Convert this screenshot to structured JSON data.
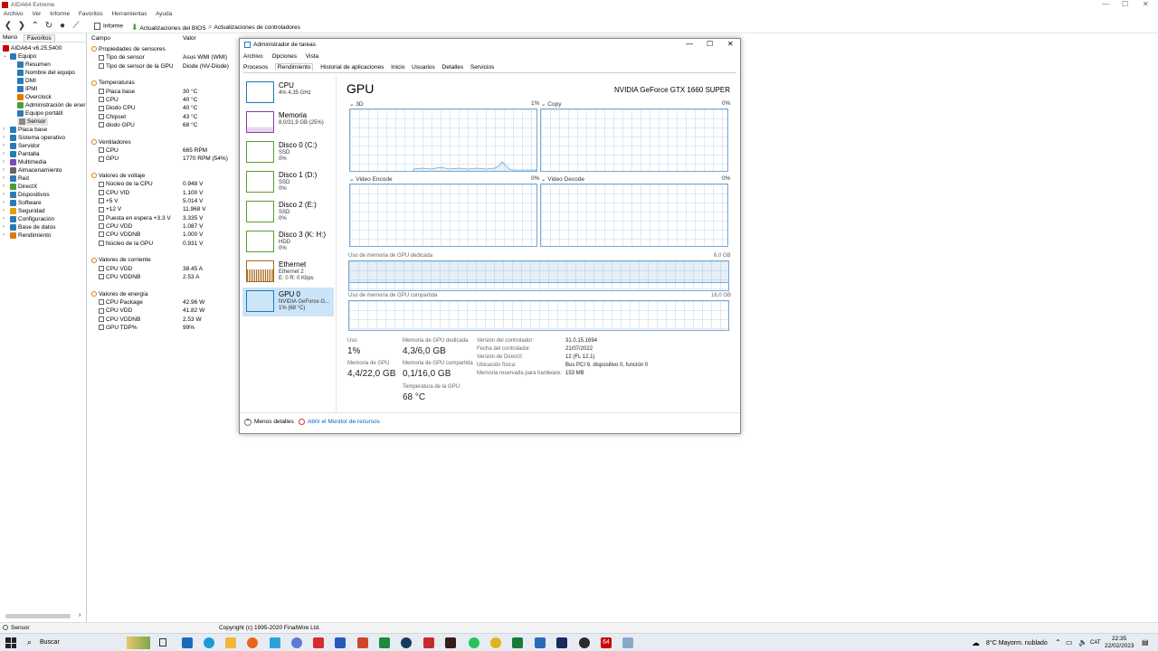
{
  "aida": {
    "title": "AIDA64 Extreme",
    "menu": [
      "Archivo",
      "Ver",
      "Informe",
      "Favoritos",
      "Herramientas",
      "Ayuda"
    ],
    "toolbar": {
      "report": "Informe",
      "bios": "Actualizaciones del BIOS",
      "drivers": "Actualizaciones de controladores"
    },
    "left_tabs": [
      "Menú",
      "Favoritos"
    ],
    "tree": [
      {
        "label": "AIDA64 v6.25.5400",
        "color": "#c00"
      },
      {
        "label": "Equipo",
        "color": "#2a7ab8"
      },
      {
        "label": "Resumen",
        "color": "#2a7ab8"
      },
      {
        "label": "Nombre del equipo",
        "color": "#2a7ab8"
      },
      {
        "label": "DMI",
        "color": "#2a7ab8"
      },
      {
        "label": "IPMI",
        "color": "#2a7ab8"
      },
      {
        "label": "Overclock",
        "color": "#e07b00"
      },
      {
        "label": "Administración de ener",
        "color": "#4a9e3a"
      },
      {
        "label": "Equipo portátil",
        "color": "#2a7ab8"
      },
      {
        "label": "Sensor",
        "color": "#888"
      },
      {
        "label": "Placa base",
        "color": "#2a7ab8"
      },
      {
        "label": "Sistema operativo",
        "color": "#2a7ab8"
      },
      {
        "label": "Servidor",
        "color": "#2a7ab8"
      },
      {
        "label": "Pantalla",
        "color": "#2a7ab8"
      },
      {
        "label": "Multimedia",
        "color": "#7a4ab8"
      },
      {
        "label": "Almacenamiento",
        "color": "#666"
      },
      {
        "label": "Red",
        "color": "#2a7ab8"
      },
      {
        "label": "DirectX",
        "color": "#4a9e3a"
      },
      {
        "label": "Dispositivos",
        "color": "#2a7ab8"
      },
      {
        "label": "Software",
        "color": "#2a7ab8"
      },
      {
        "label": "Seguridad",
        "color": "#e0a000"
      },
      {
        "label": "Configuración",
        "color": "#2a7ab8"
      },
      {
        "label": "Base de datos",
        "color": "#2a7ab8"
      },
      {
        "label": "Rendimiento",
        "color": "#e07b00"
      }
    ],
    "columns": {
      "field": "Campo",
      "value": "Valor"
    },
    "sections": [
      {
        "title": "Propiedades de sensores",
        "rows": [
          [
            "Tipo de sensor",
            "Asus WMI  (WMI)"
          ],
          [
            "Tipo de sensor de la GPU",
            "Diode  (NV-Diode)"
          ]
        ]
      },
      {
        "title": "Temperaturas",
        "rows": [
          [
            "Placa base",
            "30 °C"
          ],
          [
            "CPU",
            "40 °C"
          ],
          [
            "Diodo CPU",
            "40 °C"
          ],
          [
            "Chipset",
            "43 °C"
          ],
          [
            "diodo GPU",
            "68 °C"
          ]
        ]
      },
      {
        "title": "Ventiladores",
        "rows": [
          [
            "CPU",
            "665 RPM"
          ],
          [
            "GPU",
            "1770 RPM  (54%)"
          ]
        ]
      },
      {
        "title": "Valores de voltaje",
        "rows": [
          [
            "Núcleo de la CPU",
            "0.948 V"
          ],
          [
            "CPU VID",
            "1.100 V"
          ],
          [
            "+5 V",
            "5.014 V"
          ],
          [
            "+12 V",
            "11.968 V"
          ],
          [
            "Puesta en espera +3.3 V",
            "3.335 V"
          ],
          [
            "CPU VDD",
            "1.087 V"
          ],
          [
            "CPU VDDNB",
            "1.000 V"
          ],
          [
            "Núcleo de la GPU",
            "0.931 V"
          ]
        ]
      },
      {
        "title": "Valores de corriente",
        "rows": [
          [
            "CPU VDD",
            "38.45 A"
          ],
          [
            "CPU VDDNB",
            "2.53 A"
          ]
        ]
      },
      {
        "title": "Valores de energía",
        "rows": [
          [
            "CPU Package",
            "42.96 W"
          ],
          [
            "CPU VDD",
            "41.82 W"
          ],
          [
            "CPU VDDNB",
            "2.53 W"
          ],
          [
            "GPU TDP%",
            "99%"
          ]
        ]
      }
    ],
    "status_left": "Sensor",
    "status_center": "Copyright (c) 1995-2020 FinalWire Ltd."
  },
  "tm": {
    "title": "Administrador de tareas",
    "menu": [
      "Archivo",
      "Opciones",
      "Vista"
    ],
    "tabs": [
      "Procesos",
      "Rendimiento",
      "Historial de aplicaciones",
      "Inicio",
      "Usuarios",
      "Detalles",
      "Servicios"
    ],
    "side": [
      {
        "t1": "CPU",
        "t2": "4% 4,35 GHz",
        "t3": "",
        "color": "#1e7ab8"
      },
      {
        "t1": "Memoria",
        "t2": "8,0/31,9 GB (25%)",
        "t3": "",
        "color": "#8b3ca8"
      },
      {
        "t1": "Disco 0 (C:)",
        "t2": "SSD",
        "t3": "0%",
        "color": "#5a9e2a"
      },
      {
        "t1": "Disco 1 (D:)",
        "t2": "SSD",
        "t3": "0%",
        "color": "#5a9e2a"
      },
      {
        "t1": "Disco 2 (E:)",
        "t2": "SSD",
        "t3": "0%",
        "color": "#5a9e2a"
      },
      {
        "t1": "Disco 3 (K: H:)",
        "t2": "HDD",
        "t3": "0%",
        "color": "#5a9e2a"
      },
      {
        "t1": "Ethernet",
        "t2": "Ethernet 2",
        "t3": "E: 0 R: 0 Kbps",
        "color": "#a76a1a"
      },
      {
        "t1": "GPU 0",
        "t2": "NVIDIA GeForce G...",
        "t3": "1% (68 °C)",
        "color": "#1e7ab8"
      }
    ],
    "gpu": {
      "heading": "GPU",
      "model": "NVIDIA GeForce GTX 1660 SUPER",
      "g3d": "3D",
      "g3d_pct": "1%",
      "copy": "Copy",
      "copy_pct": "0%",
      "venc": "Video Encode",
      "venc_pct": "0%",
      "vdec": "Video Decode",
      "vdec_pct": "0%",
      "ded_label": "Uso de memoria de GPU dedicada",
      "ded_max": "6,0 GB",
      "shared_label": "Uso de memoria de GPU compartida",
      "shared_max": "16,0 GB",
      "stats": {
        "use_l": "Uso",
        "use_v": "1%",
        "ded_l": "Memoria de GPU dedicada",
        "ded_v": "4,3/6,0 GB",
        "mem_l": "Memoria de GPU",
        "mem_v": "4,4/22,0 GB",
        "sh_l": "Memoria de GPU compartida",
        "sh_v": "0,1/16,0 GB",
        "temp_l": "Temperatura de la GPU",
        "temp_v": "68 °C"
      },
      "info": [
        [
          "Versión del controlador:",
          "31.0.15.1694"
        ],
        [
          "Fecha del controlador:",
          "21/07/2022"
        ],
        [
          "Versión de DirectX:",
          "12 (FL 12.1)"
        ],
        [
          "Ubicación física:",
          "Bus PCI 9, dispositivo 0, función 0"
        ],
        [
          "Memoria reservada para hardware:",
          "153 MB"
        ]
      ]
    },
    "less_details": "Menos detalles",
    "resmon": "Abrir el Monitor de recursos"
  },
  "taskbar": {
    "search": "Buscar",
    "weather": "8°C  Mayorm. nublado",
    "lang": "CAT",
    "time": "22:35",
    "date": "22/02/2023"
  }
}
